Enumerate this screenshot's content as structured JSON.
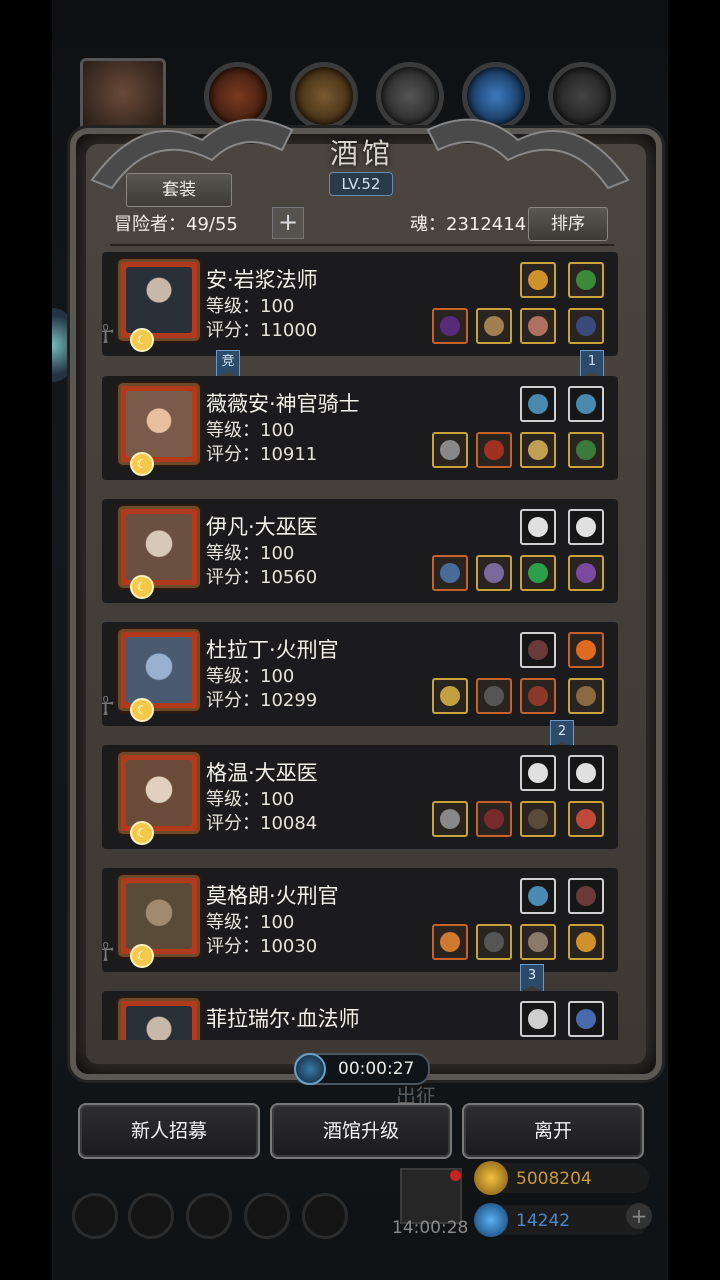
{
  "panel": {
    "title": "酒馆",
    "level": "LV.52",
    "set_button": "套装",
    "sort_button": "排序"
  },
  "header": {
    "adventurers_label": "冒险者：49/55",
    "soul_label": "魂：2312414",
    "add_symbol": "+"
  },
  "heroes": [
    {
      "name": "安·岩浆法师",
      "level": "等级：100",
      "score": "评分：11000",
      "portrait_color": "#2a3038",
      "ribbon": "竞"
    },
    {
      "name": "薇薇安·神官骑士",
      "level": "等级：100",
      "score": "评分：10911",
      "portrait_color": "#7a5a48",
      "ribbon": ""
    },
    {
      "name": "伊凡·大巫医",
      "level": "等级：100",
      "score": "评分：10560",
      "portrait_color": "#6a5040",
      "ribbon": ""
    },
    {
      "name": "杜拉丁·火刑官",
      "level": "等级：100",
      "score": "评分：10299",
      "portrait_color": "#4a5a70",
      "ribbon": "2"
    },
    {
      "name": "格温·大巫医",
      "level": "等级：100",
      "score": "评分：10084",
      "portrait_color": "#6a4a38",
      "ribbon": ""
    },
    {
      "name": "莫格朗·火刑官",
      "level": "等级：100",
      "score": "评分：10030",
      "portrait_color": "#5a4a38",
      "ribbon": "3"
    },
    {
      "name": "菲拉瑞尔·血法师",
      "level": "",
      "score": "",
      "portrait_color": "#2a3038",
      "ribbon": ""
    }
  ],
  "ribbons": {
    "first": "1",
    "second": "2",
    "third": "3",
    "arena": "竞"
  },
  "timer": "00:00:27",
  "buttons": {
    "recruit": "新人招募",
    "upgrade": "酒馆升级",
    "leave": "离开"
  },
  "background": {
    "gold": "5008204",
    "gems": "14242",
    "clock": "14:00:28",
    "sortie": "出征",
    "plus": "+"
  },
  "colors": {
    "panel": "#3a3430",
    "row": "#1b1b1d",
    "gold_border": "#b8922a",
    "ribbon_blue": "#2c4a6a"
  },
  "icons": [
    "hero-portrait",
    "gear-icon",
    "ghost-icon",
    "moon-icon",
    "clock-icon",
    "gift-icon",
    "coin-icon",
    "gem-icon"
  ]
}
